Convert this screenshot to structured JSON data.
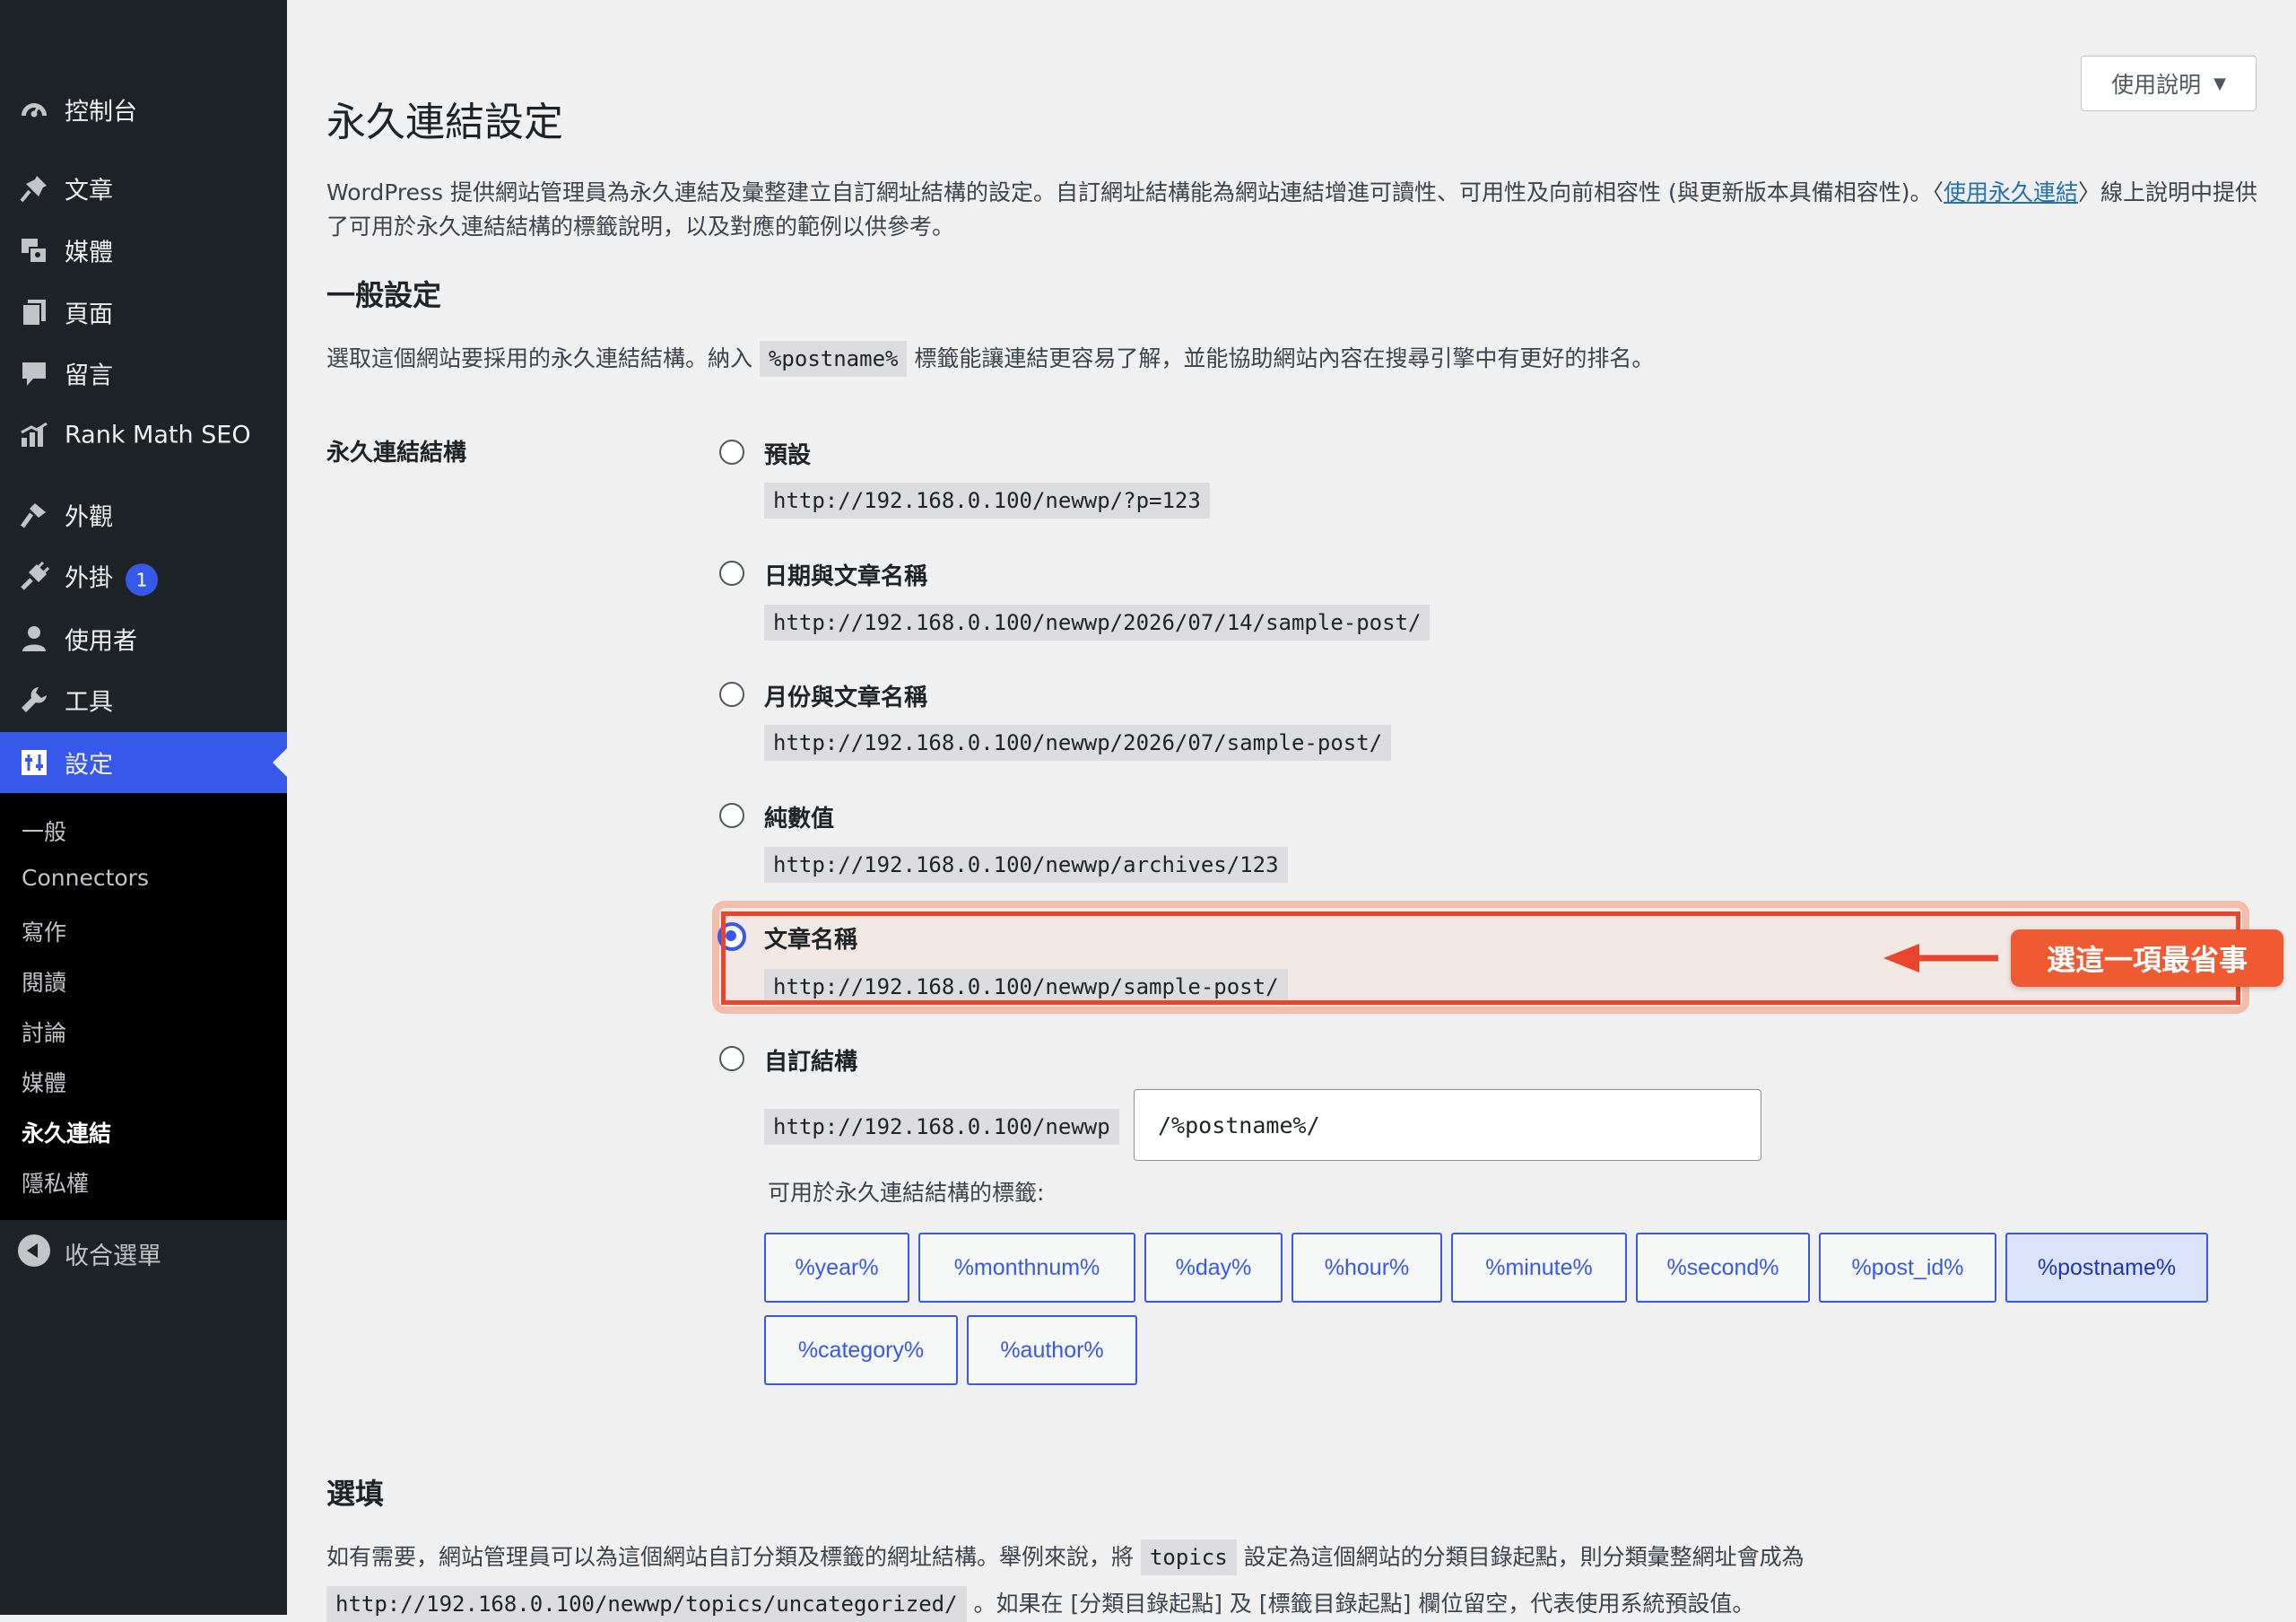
{
  "sidebar": {
    "items": [
      {
        "label": "控制台",
        "icon": "dashboard-icon"
      },
      {
        "label": "文章",
        "icon": "pin-icon"
      },
      {
        "label": "媒體",
        "icon": "media-icon"
      },
      {
        "label": "頁面",
        "icon": "pages-icon"
      },
      {
        "label": "留言",
        "icon": "comments-icon"
      },
      {
        "label": "Rank Math SEO",
        "icon": "rank-math-icon"
      },
      {
        "label": "外觀",
        "icon": "appearance-icon"
      },
      {
        "label": "外掛",
        "icon": "plugins-icon",
        "badge": "1"
      },
      {
        "label": "使用者",
        "icon": "users-icon"
      },
      {
        "label": "工具",
        "icon": "tools-icon"
      },
      {
        "label": "設定",
        "icon": "settings-icon",
        "active": true
      }
    ],
    "submenu": [
      "一般",
      "Connectors",
      "寫作",
      "閱讀",
      "討論",
      "媒體",
      "永久連結",
      "隱私權"
    ],
    "submenu_current": "永久連結",
    "collapse_label": "收合選單"
  },
  "header": {
    "help_button": "使用說明",
    "title": "永久連結設定"
  },
  "intro": {
    "text_before_link": "WordPress 提供網站管理員為永久連結及彙整建立自訂網址結構的設定。自訂網址結構能為網站連結增進可讀性、可用性及向前相容性 (與更新版本具備相容性)。〈",
    "link": "使用永久連結",
    "text_after_link": "〉線上說明中提供了可用於永久連結結構的標籤說明，以及對應的範例以供參考。"
  },
  "general": {
    "heading": "一般設定",
    "desc_before": "選取這個網站要採用的永久連結結構。納入",
    "desc_code": "%postname%",
    "desc_after": "標籤能讓連結更容易了解，並能協助網站內容在搜尋引擎中有更好的排名。",
    "field_label": "永久連結結構",
    "options": [
      {
        "label": "預設",
        "url": "http://192.168.0.100/newwp/?p=123",
        "checked": false
      },
      {
        "label": "日期與文章名稱",
        "url": "http://192.168.0.100/newwp/2026/07/14/sample-post/",
        "checked": false
      },
      {
        "label": "月份與文章名稱",
        "url": "http://192.168.0.100/newwp/2026/07/sample-post/",
        "checked": false
      },
      {
        "label": "純數值",
        "url": "http://192.168.0.100/newwp/archives/123",
        "checked": false
      },
      {
        "label": "文章名稱",
        "url": "http://192.168.0.100/newwp/sample-post/",
        "checked": true
      },
      {
        "label": "自訂結構",
        "url": "http://192.168.0.100/newwp",
        "checked": false
      }
    ],
    "custom_value": "/%postname%/",
    "tags_label": "可用於永久連結結構的標籤:",
    "tags": [
      "%year%",
      "%monthnum%",
      "%day%",
      "%hour%",
      "%minute%",
      "%second%",
      "%post_id%",
      "%postname%",
      "%category%",
      "%author%"
    ],
    "active_tag": "%postname%"
  },
  "annotation": {
    "callout": "選這一項最省事",
    "color": "#f05a32"
  },
  "optional": {
    "heading": "選填",
    "p1_before": "如有需要，網站管理員可以為這個網站自訂分類及標籤的網址結構。舉例來說，將",
    "p1_code": "topics",
    "p1_after": "設定為這個網站的分類目錄起點，則分類彙整網址會成為",
    "p2_code": "http://192.168.0.100/newwp/topics/uncategorized/",
    "p2_after": "。如果在 [分類目錄起點] 及 [標籤目錄起點] 欄位留空，代表使用系統預設值。"
  },
  "colors": {
    "sidebar_bg": "#1d2327",
    "accent": "#3858e9",
    "link": "#2271b1"
  }
}
